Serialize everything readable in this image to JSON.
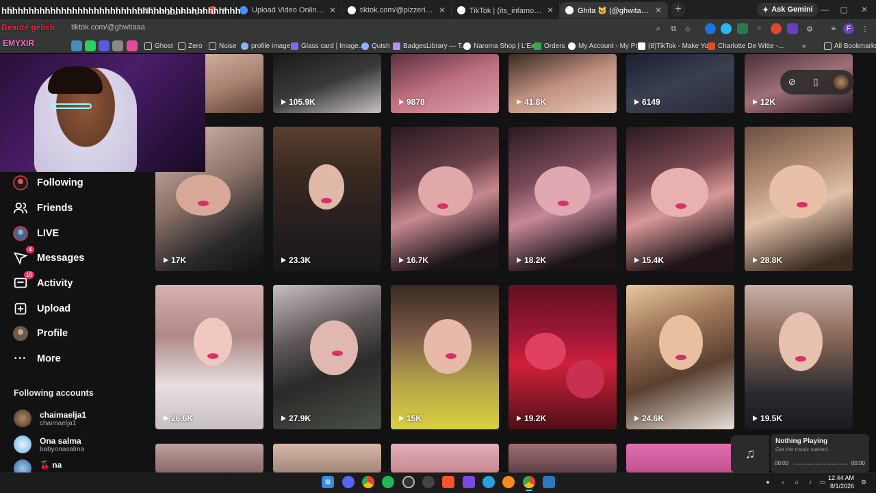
{
  "browser": {
    "tabs": [
      {
        "title": "حرجنا ندورو ف (235)",
        "favicon_color": "#ff4e45",
        "active": false
      },
      {
        "title": "Upload Video Online - Free Vi",
        "favicon_color": "#4a90ff",
        "active": false
      },
      {
        "title": "tiktok.com/@pizzeriasouli33/liv",
        "favicon_color": "#ffffff",
        "active": false
      },
      {
        "title": "TikTok | (its_infamous@) كريم",
        "favicon_color": "#ffffff",
        "active": false
      },
      {
        "title": "Ghita 🐱 (@ghwitaaa) | TikTok",
        "favicon_color": "#ffffff",
        "active": true
      }
    ],
    "new_tab": "+",
    "ask_gemini": "Ask Gemini",
    "window_controls": {
      "minimize": "—",
      "maximize": "▢",
      "close": "✕"
    },
    "url_prefix": "tiktok.c",
    "url_visible": "om/@ghwitaaa",
    "bookmarks": [
      {
        "label": "Ghost",
        "icon": "folder-icon",
        "color": "#cfcfcf"
      },
      {
        "label": "Zero",
        "icon": "folder-icon",
        "color": "#cfcfcf"
      },
      {
        "label": "Noise",
        "icon": "folder-icon",
        "color": "#cfcfcf"
      },
      {
        "label": "profile image",
        "icon": "globe-icon",
        "color": "#8ab4f8"
      },
      {
        "label": "Glass card | Image...",
        "icon": "glass-icon",
        "color": "#7a6cf0"
      },
      {
        "label": "Qutsh",
        "icon": "globe-icon",
        "color": "#8ab4f8"
      },
      {
        "label": "BadgesLibrary — T...",
        "icon": "badge-icon",
        "color": "#b48cff"
      },
      {
        "label": "Naroma Shop | L'Ex...",
        "icon": "naroma-icon",
        "color": "#ffffff"
      },
      {
        "label": "Orders",
        "icon": "orders-icon",
        "color": "#34a853"
      },
      {
        "label": "My Account - My Pr...",
        "icon": "account-icon",
        "color": "#ffffff"
      },
      {
        "label": "(8)TikTok - Make Yo...",
        "icon": "tiktok-icon",
        "color": "#ffffff"
      },
      {
        "label": "Charlotte De Witte -...",
        "icon": "charlotte-icon",
        "color": "#e04a2a"
      }
    ],
    "bookmarks_more": "»",
    "all_bookmarks": "All Bookmarks"
  },
  "stream_overlay": {
    "spam_text": "hhhhhhhhhhhhhhhhhhhhhhhhhhhhhhhhhhhhhhhhhhhh",
    "beauty_text": "Beauté gelich",
    "name_text": "EMYXIR"
  },
  "sidebar": {
    "items": [
      {
        "label": "Following",
        "icon": "following-icon",
        "badge": ""
      },
      {
        "label": "Friends",
        "icon": "friends-icon",
        "badge": ""
      },
      {
        "label": "LIVE",
        "icon": "live-icon",
        "badge": ""
      },
      {
        "label": "Messages",
        "icon": "messages-icon",
        "badge": "4"
      },
      {
        "label": "Activity",
        "icon": "activity-icon",
        "badge": "10"
      },
      {
        "label": "Upload",
        "icon": "upload-icon",
        "badge": ""
      },
      {
        "label": "Profile",
        "icon": "profile-icon",
        "badge": ""
      },
      {
        "label": "More",
        "icon": "more-icon",
        "badge": ""
      }
    ],
    "following_title": "Following accounts",
    "following_accounts": [
      {
        "name": "chaimaelja1",
        "handle": "chaimaelja1",
        "color": "#7a5a40"
      },
      {
        "name": "Ona salma",
        "handle": "babyonasalma",
        "color": "#9fd0ee"
      },
      {
        "name": "🍒 na",
        "handle": "",
        "color": "#5a8ac0"
      }
    ]
  },
  "grid": {
    "row1": [
      "105.9K",
      "9878",
      "41.8K",
      "6149",
      "12K"
    ],
    "row2": [
      "17K",
      "23.3K",
      "16.7K",
      "18.2K",
      "15.4K",
      "28.8K"
    ],
    "row3": [
      "26.6K",
      "27.9K",
      "15K",
      "19.2K",
      "24.6K",
      "19.5K"
    ],
    "tone_colors": [
      "#c79a86",
      "#3a2a28",
      "#b87a84",
      "#6a4a48",
      "#3a3848",
      "#c8a090"
    ]
  },
  "media_popup": {
    "title": "Nothing Playing",
    "subtitle": "Get the music started",
    "time_start": "00:00",
    "time_end": "00:00"
  },
  "taskbar": {
    "time": "12:44 AM",
    "date": "8/1/2026",
    "apps": [
      "start",
      "discord",
      "chrome",
      "spotify",
      "obs",
      "app",
      "brave",
      "vpn",
      "telegram",
      "firefox",
      "chrome-active",
      "snip"
    ]
  },
  "colors": {
    "accent": "#fe2c55",
    "page_bg": "#121212",
    "chrome_bg": "#353636"
  }
}
